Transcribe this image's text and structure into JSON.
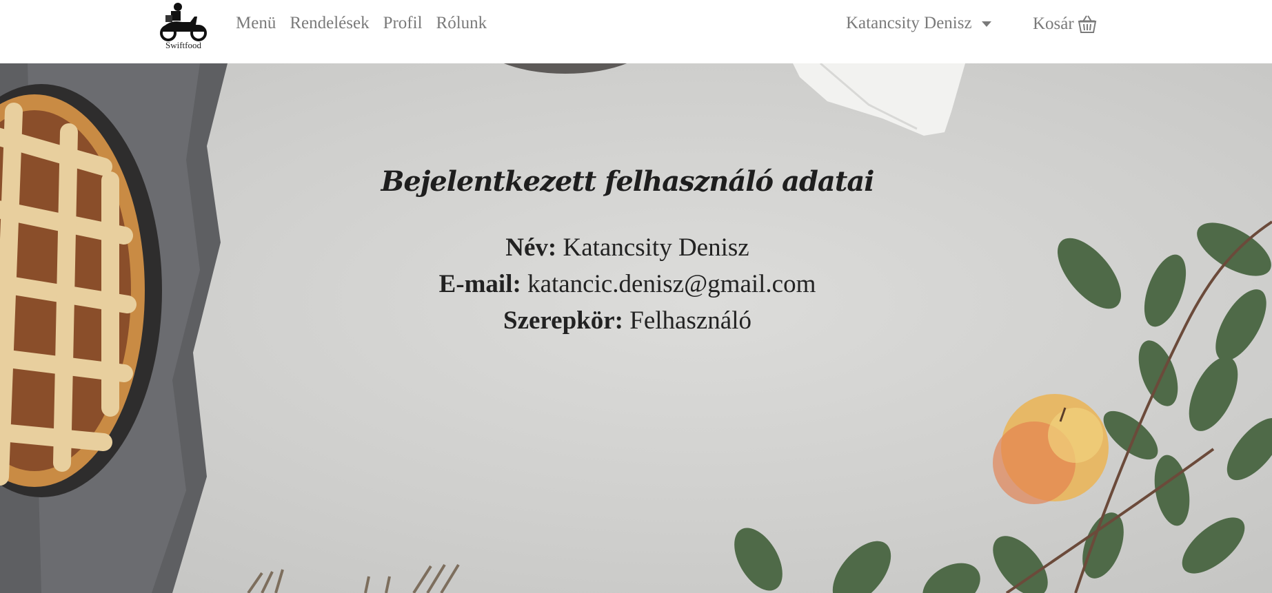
{
  "brand": {
    "logo_text": "Swiftfood"
  },
  "nav": {
    "links": [
      "Menü",
      "Rendelések",
      "Profil",
      "Rólunk"
    ],
    "user_name": "Katancsity Denisz",
    "cart_label": "Kosár"
  },
  "main": {
    "title": "Bejelentkezett felhasználó adatai",
    "fields": [
      {
        "label": "Név:",
        "value": "Katancsity Denisz"
      },
      {
        "label": "E-mail:",
        "value": "katancic.denisz@gmail.com"
      },
      {
        "label": "Szerepkör:",
        "value": "Felhasználó"
      }
    ]
  },
  "colors": {
    "nav_text": "#7a7a7a",
    "background": "#d6d6d4",
    "title": "#1e1e1e"
  },
  "icons": [
    "scooter-logo",
    "caret-down-icon",
    "basket-icon"
  ]
}
